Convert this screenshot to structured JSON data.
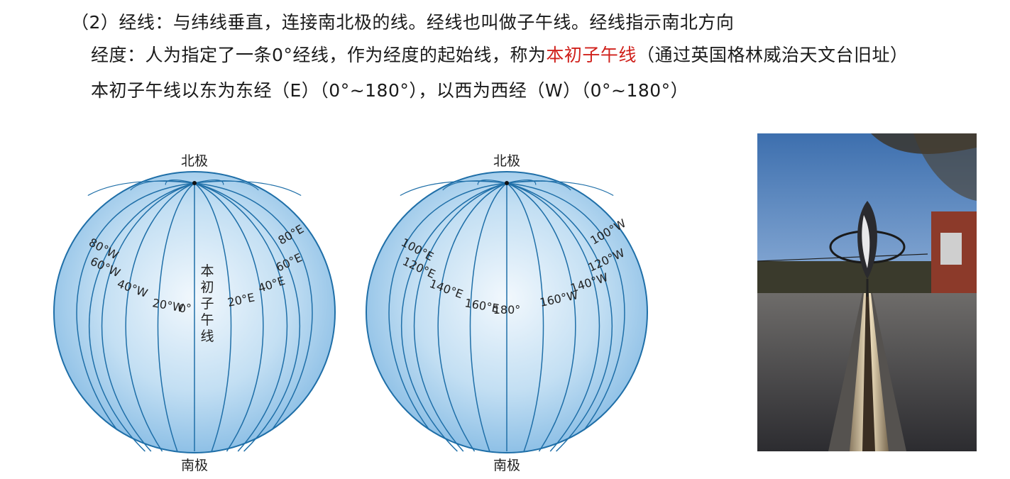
{
  "text": {
    "line1": "（2）经线：与纬线垂直，连接南北极的线。经线也叫做子午线。经线指示南北方向",
    "line2_pre": "经度：人为指定了一条0°经线，作为经度的起始线，称为",
    "line2_highlight": "本初子午线",
    "line2_post": "（通过英国格林威治天文台旧址）",
    "line3": "本初子午线以东为东经（E）（0°~180°），以西为西经（W）（0°~180°）"
  },
  "colors": {
    "highlight": "#d0211c",
    "globe_fill": "#9fcbec",
    "globe_line": "#1f6fa8"
  },
  "globe_left": {
    "north": "北极",
    "south": "南极",
    "prime_label": "本初子午线",
    "labels_west": [
      "80°W",
      "60°W",
      "40°W",
      "20°W"
    ],
    "center": "0°",
    "labels_east": [
      "20°E",
      "40°E",
      "60°E",
      "80°E"
    ]
  },
  "globe_right": {
    "north": "北极",
    "south": "南极",
    "labels_west_side": [
      "100°E",
      "120°E",
      "140°E",
      "160°E"
    ],
    "center": "180°",
    "labels_east_side": [
      "160°W",
      "140°W",
      "120°W",
      "100°W"
    ]
  },
  "photo": {
    "subject": "greenwich-prime-meridian-line-photo"
  }
}
